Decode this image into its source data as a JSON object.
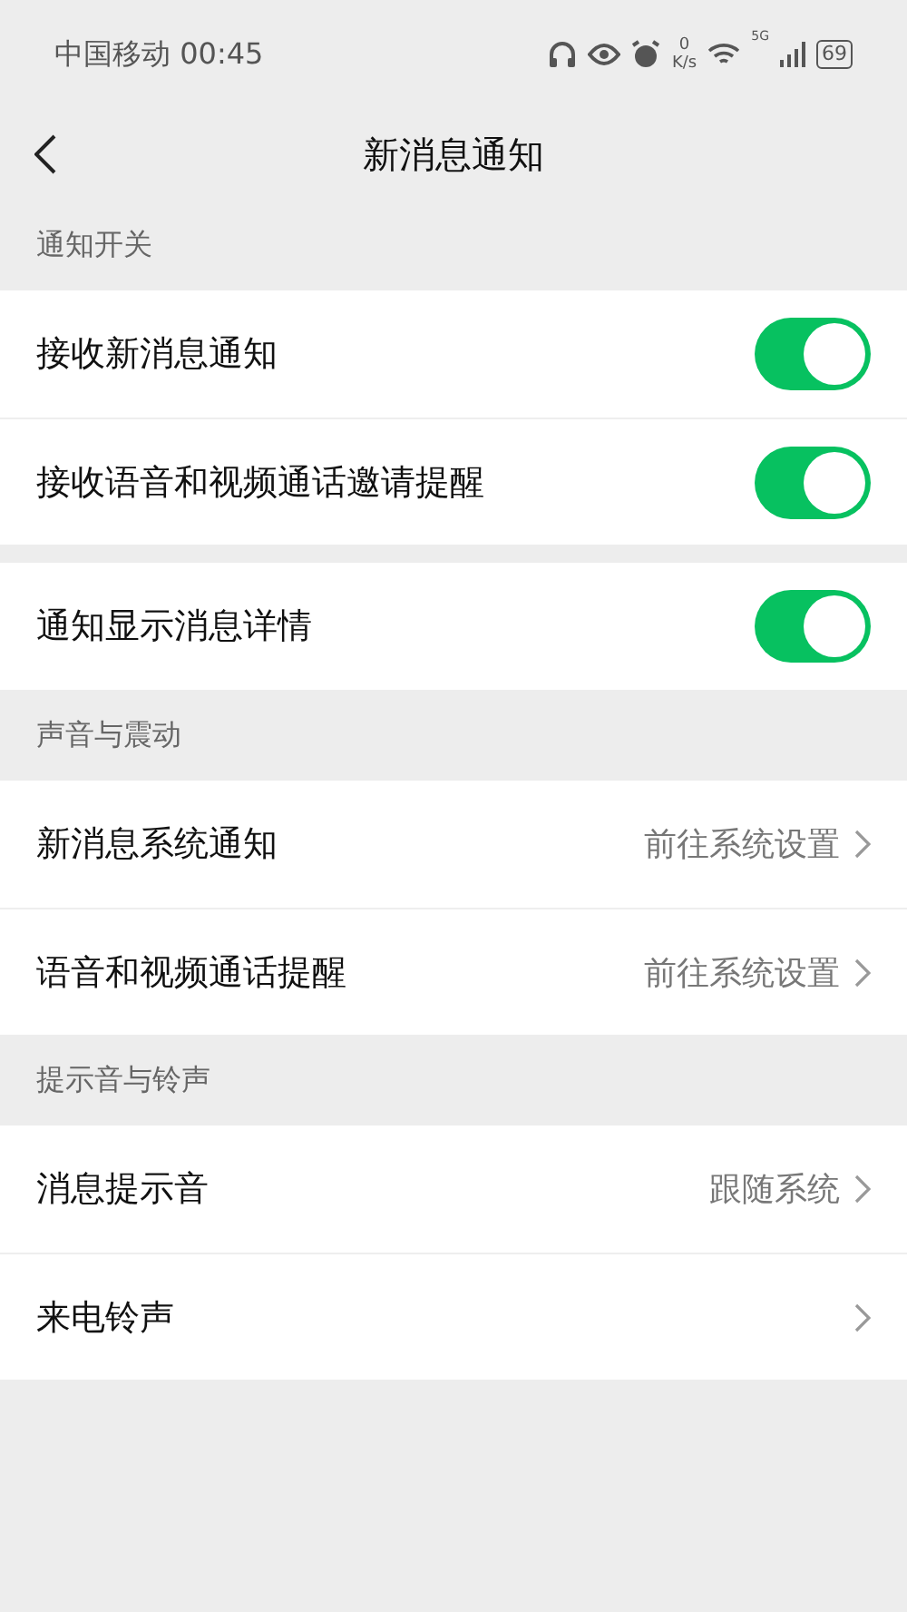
{
  "status_bar": {
    "carrier_time": "中国移动 00:45",
    "speed_value": "0",
    "speed_unit": "K/s",
    "network": "5G",
    "battery": "69"
  },
  "nav": {
    "title": "新消息通知"
  },
  "sections": [
    {
      "header": "通知开关",
      "groups": [
        [
          {
            "kind": "toggle",
            "label": "接收新消息通知",
            "on": true
          },
          {
            "kind": "toggle",
            "label": "接收语音和视频通话邀请提醒",
            "on": true
          }
        ],
        [
          {
            "kind": "toggle",
            "label": "通知显示消息详情",
            "on": true
          }
        ]
      ]
    },
    {
      "header": "声音与震动",
      "groups": [
        [
          {
            "kind": "link",
            "label": "新消息系统通知",
            "value": "前往系统设置"
          },
          {
            "kind": "link",
            "label": "语音和视频通话提醒",
            "value": "前往系统设置"
          }
        ]
      ]
    },
    {
      "header": "提示音与铃声",
      "groups": [
        [
          {
            "kind": "link",
            "label": "消息提示音",
            "value": "跟随系统"
          },
          {
            "kind": "link",
            "label": "来电铃声"
          }
        ]
      ]
    }
  ]
}
